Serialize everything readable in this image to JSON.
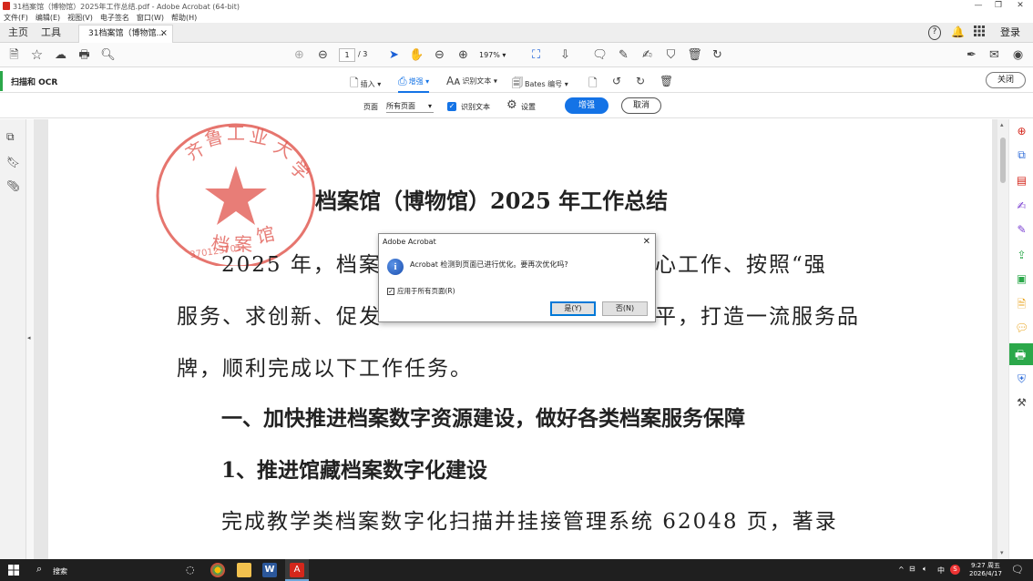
{
  "window": {
    "title": "31档案馆（博物馆）2025年工作总结.pdf - Adobe Acrobat (64-bit)",
    "controls": [
      "—",
      "❐",
      "✕"
    ]
  },
  "menubar": [
    "文件(F)",
    "编辑(E)",
    "视图(V)",
    "电子签名",
    "窗口(W)",
    "帮助(H)"
  ],
  "tabs": {
    "home": "主页",
    "tools": "工具",
    "document": "31档案馆（博物馆...",
    "close": "×",
    "login": "登录"
  },
  "toolbar": {
    "page_current": "1",
    "page_total": "/ 3",
    "zoom": "197%"
  },
  "scan": {
    "label": "扫描和 OCR",
    "insert": "插入",
    "enhance": "增强",
    "recognize": "识别文本",
    "bates": "Bates 编号",
    "close": "关闭"
  },
  "enhance_bar": {
    "pages_label": "页面",
    "pages_value": "所有页面",
    "recognize_label": "识别文本",
    "settings": "设置",
    "enhance_button": "增强",
    "cancel_button": "取消"
  },
  "document": {
    "title": "档案馆（博物馆）2025 年工作总结",
    "para1_line1": "2025 年，档案馆",
    "para1_line1_end": "心工作、按照“强",
    "para1_line2_start": "服务、求创新、促发",
    "para1_line2_end": "平，打造一流服务品",
    "para1_line3": "牌，顺利完成以下工作任务。",
    "heading1": "一、加快推进档案数字资源建设，做好各类档案服务保障",
    "heading2": "1、推进馆藏档案数字化建设",
    "para2": "完成教学类档案数字化扫描并挂接管理系统 62048 页，著录",
    "seal_top": "齐鲁工业大学",
    "seal_bottom": "档案馆",
    "seal_number": "370123701"
  },
  "dialog": {
    "title": "Adobe Acrobat",
    "message": "Acrobat 检测到页面已进行优化。要再次优化吗?",
    "checkbox_label": "应用于所有页面(R)",
    "yes": "是(Y)",
    "no": "否(N)"
  },
  "taskbar": {
    "search": "搜索",
    "ime": "中",
    "time": "9:27 周五",
    "date": "2026/4/17"
  },
  "colors": {
    "accent_blue": "#1473e6",
    "green": "#2ba84a",
    "seal_red": "#e0524a"
  }
}
